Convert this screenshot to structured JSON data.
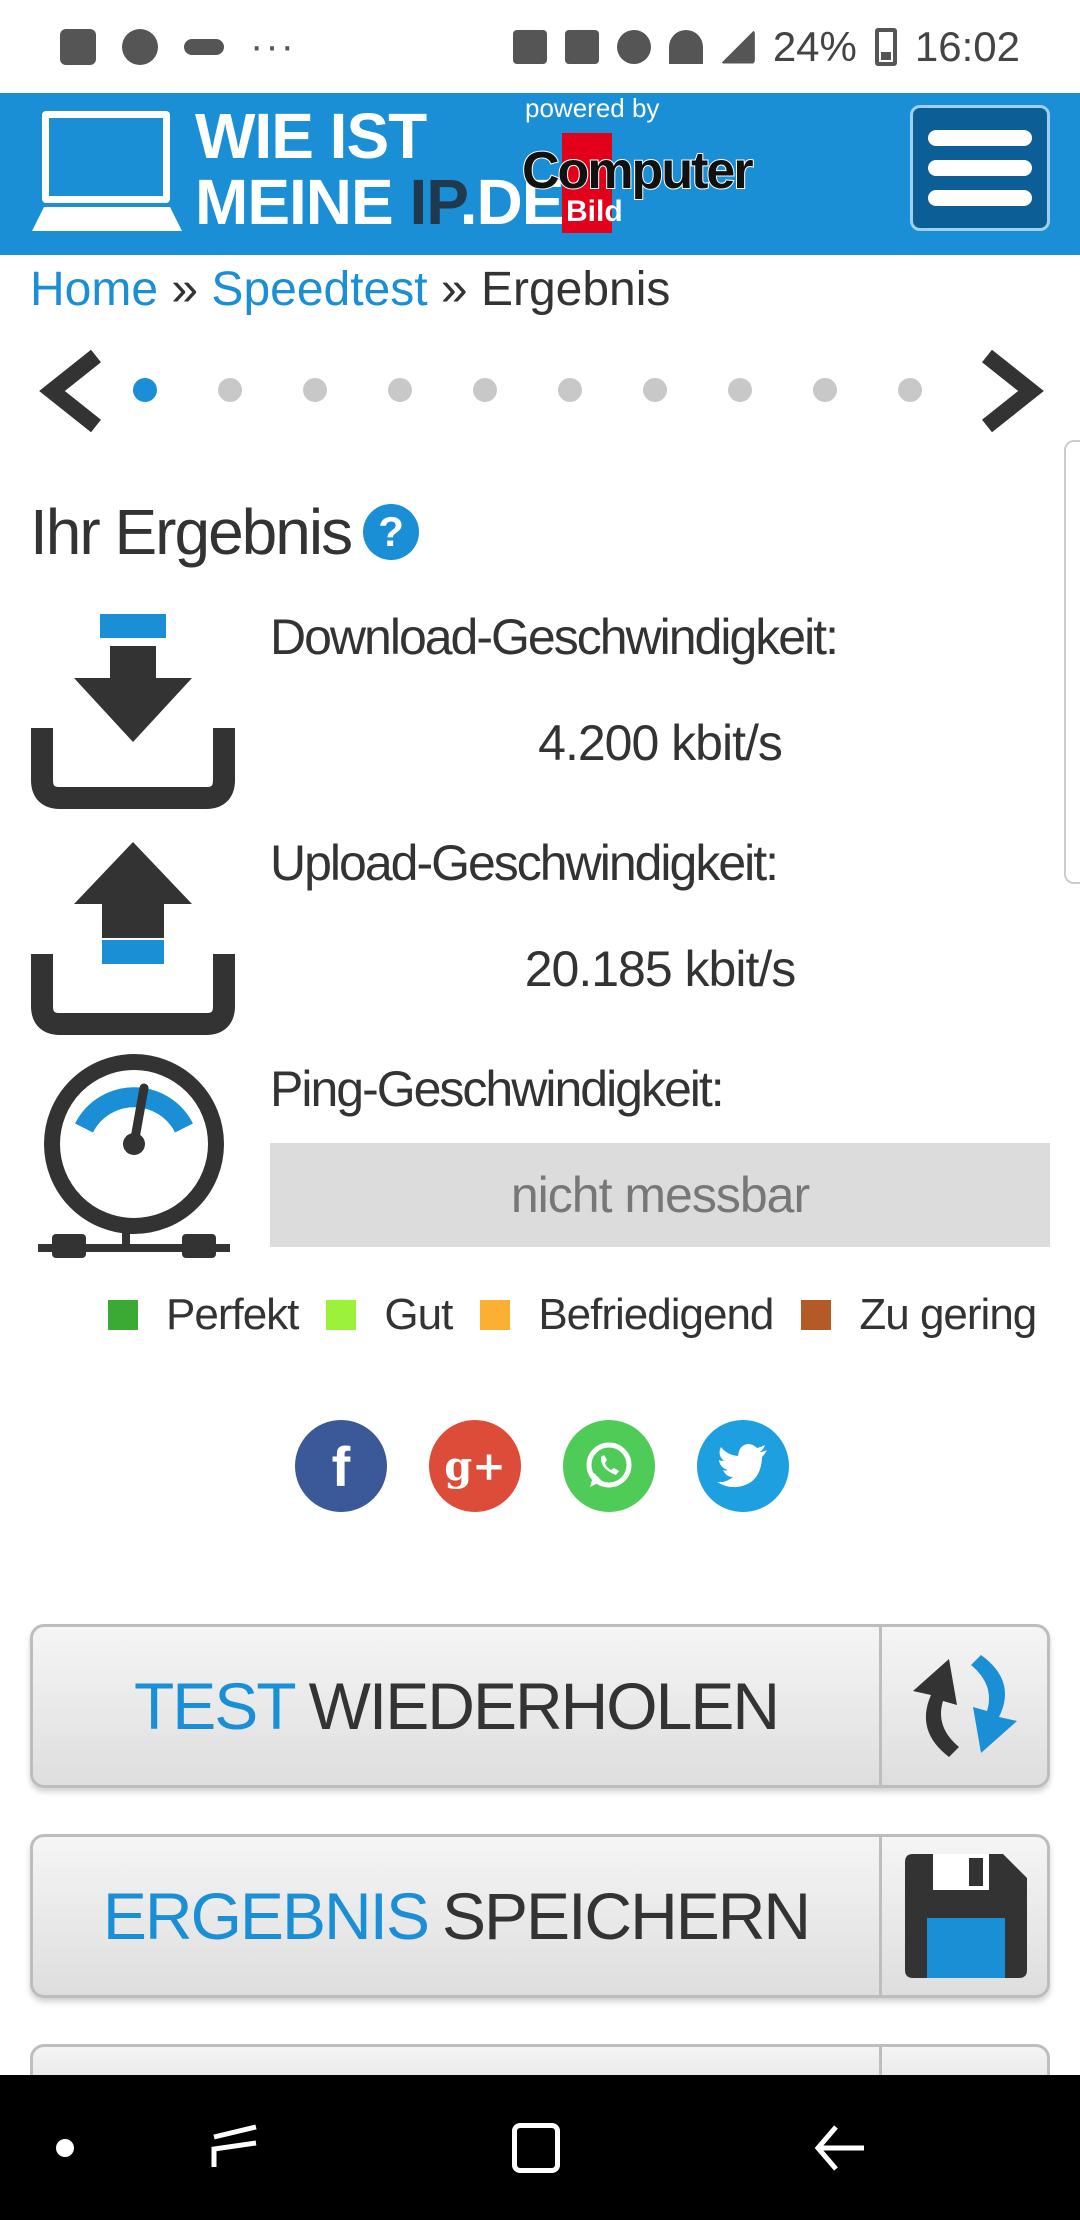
{
  "status_bar": {
    "battery": "24%",
    "time": "16:02",
    "left_icons": [
      "gallery-icon",
      "ghost-icon",
      "key-icon",
      "more-dots-icon"
    ],
    "right_icons": [
      "bluetooth-icon",
      "mute-icon",
      "alarm-icon",
      "wifi-icon",
      "signal-icon",
      "battery-icon"
    ]
  },
  "header": {
    "logo_line1": "WIE IST",
    "logo_line2_a": "MEINE ",
    "logo_line2_b": "IP",
    "logo_line2_c": ".DE",
    "powered_by": "powered by",
    "partner_name": "Computer",
    "partner_sub": "Bild",
    "brand_color": "#1a8fd6"
  },
  "breadcrumb": {
    "home": "Home",
    "sep1": " » ",
    "speedtest": "Speedtest",
    "sep2": " » ",
    "current": "Ergebnis"
  },
  "carousel": {
    "dot_count": 10,
    "active_index": 0
  },
  "results": {
    "title": "Ihr Ergebnis",
    "help": "?",
    "download_label": "Download-Geschwindigkeit:",
    "download_value": "4.200 kbit/s",
    "upload_label": "Upload-Geschwindigkeit:",
    "upload_value": "20.185 kbit/s",
    "ping_label": "Ping-Geschwindigkeit:",
    "ping_value": "nicht messbar"
  },
  "legend": [
    {
      "label": "Perfekt",
      "color": "#3aaa35"
    },
    {
      "label": "Gut",
      "color": "#9cf23a"
    },
    {
      "label": "Befriedigend",
      "color": "#fbb034"
    },
    {
      "label": "Zu gering",
      "color": "#b45a26"
    }
  ],
  "social": {
    "facebook": "f",
    "googleplus": "g+"
  },
  "actions": {
    "repeat_hl": "TEST",
    "repeat_rest": "WIEDERHOLEN",
    "save_hl": "ERGEBNIS",
    "save_rest": "SPEICHERN"
  }
}
